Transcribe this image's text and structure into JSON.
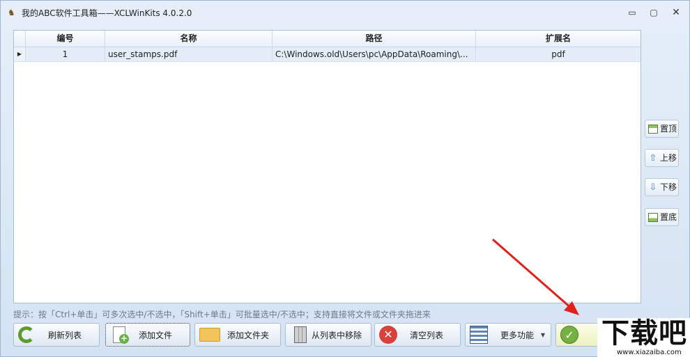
{
  "window": {
    "title": "我的ABC软件工具箱——XCLWinKits  4.0.2.0",
    "minimize": "▭",
    "maximize": "▢",
    "close": "✕"
  },
  "grid": {
    "columns": [
      "编号",
      "名称",
      "路径",
      "扩展名"
    ],
    "rows": [
      {
        "indicator": "▶",
        "number": "1",
        "name": "user_stamps.pdf",
        "path": "C:\\Windows.old\\Users\\pc\\AppData\\Roaming\\...",
        "ext": "pdf"
      }
    ]
  },
  "side_buttons": {
    "top": "置顶",
    "up": "上移",
    "down": "下移",
    "bottom": "置底"
  },
  "hint": "提示：按「Ctrl+单击」可多次选中/不选中，「Shift+单击」可批量选中/不选中；支持直接将文件或文件夹拖进来",
  "bottom_buttons": {
    "refresh": "刷新列表",
    "add_file": "添加文件",
    "add_folder": "添加文件夹",
    "remove": "从列表中移除",
    "clear": "清空列表",
    "more": "更多功能"
  },
  "icons": {
    "refresh": "refresh-icon",
    "add_file": "add-file-icon",
    "folder": "folder-icon",
    "trash": "trash-icon",
    "clear": "clear-icon",
    "list": "list-icon",
    "check": "check-icon"
  },
  "watermark": {
    "main": "下载吧",
    "sub": "www.xiazaiba.com"
  },
  "colors": {
    "accent": "#3d7fc1",
    "arrow": "#e0201a",
    "selected_row": "#e4edf8"
  }
}
